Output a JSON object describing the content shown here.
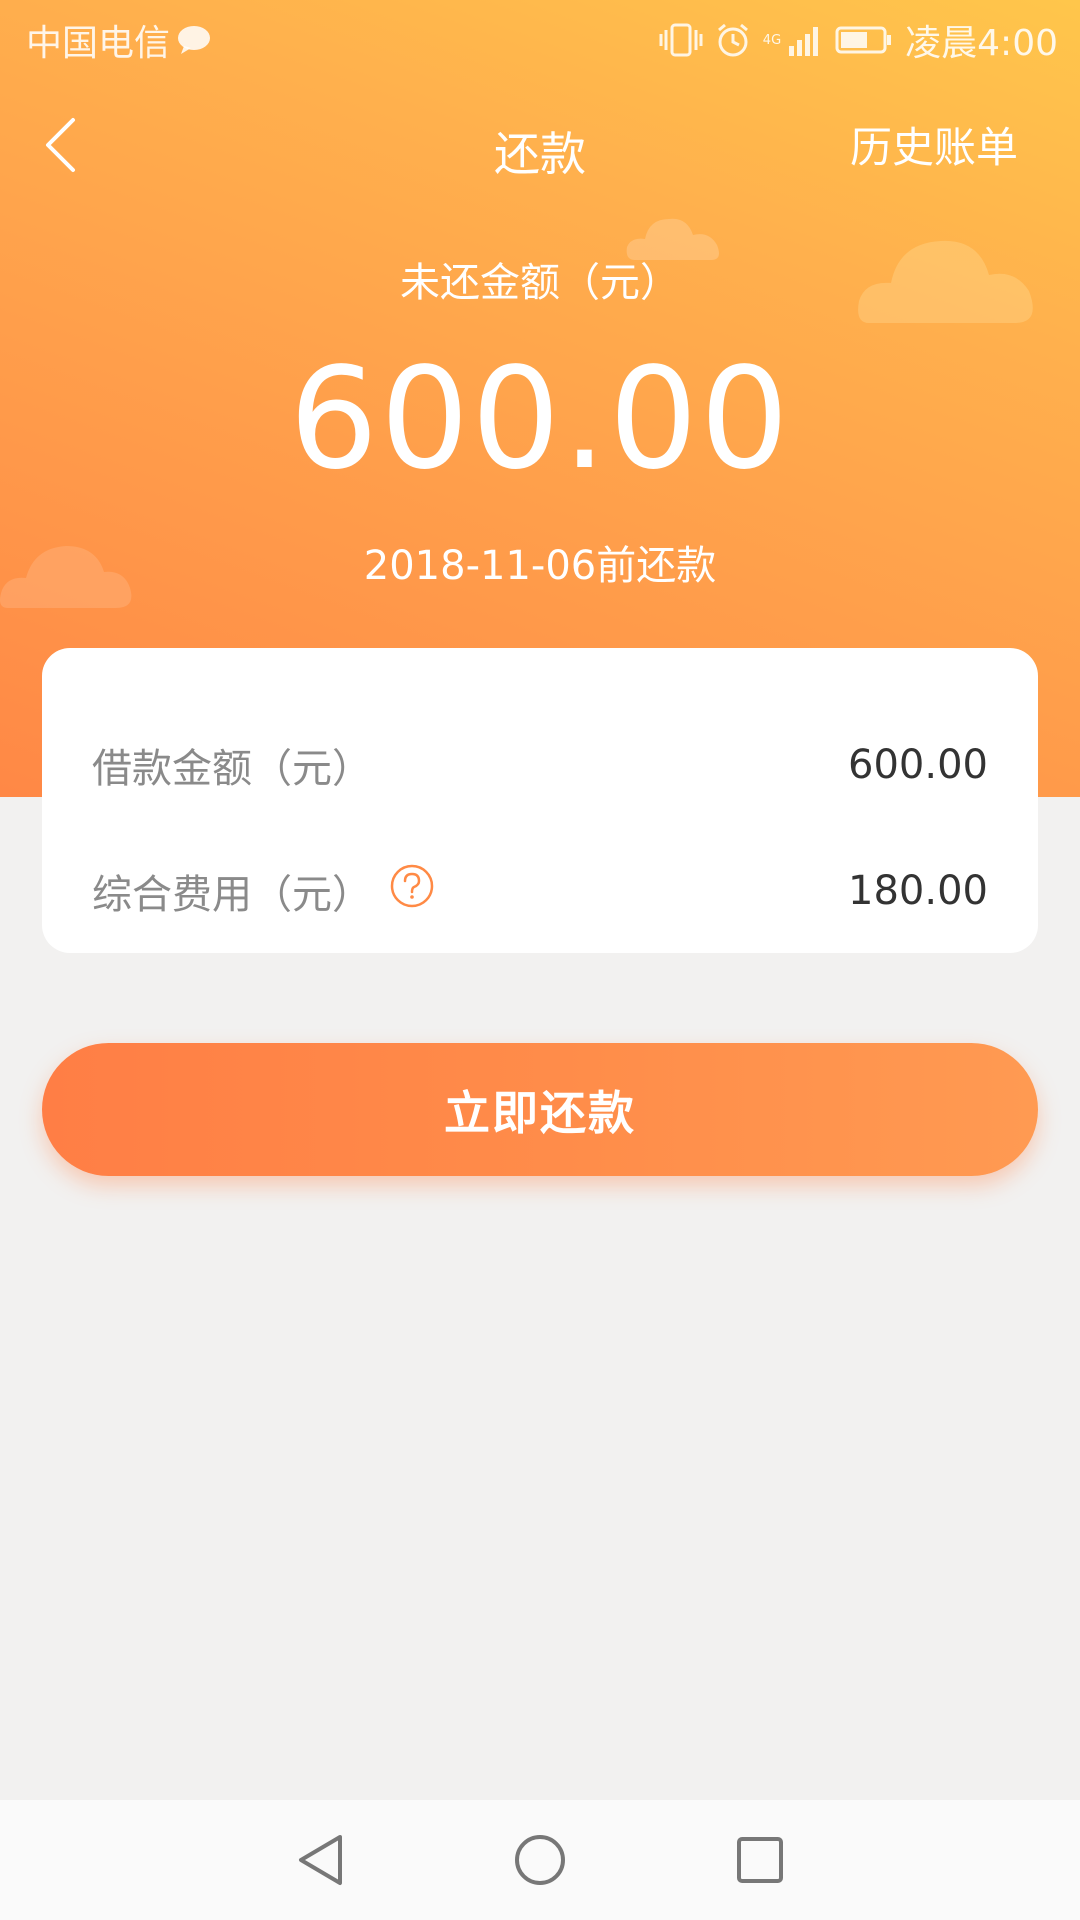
{
  "status_bar": {
    "carrier": "中国电信",
    "network": "4G",
    "time": "凌晨4:00"
  },
  "nav": {
    "title": "还款",
    "history_label": "历史账单"
  },
  "summary": {
    "amount_label": "未还金额（元）",
    "amount_value": "600.00",
    "due_text": "2018-11-06前还款"
  },
  "details": {
    "rows": [
      {
        "label": "借款金额（元）",
        "value": "600.00"
      },
      {
        "label": "综合费用（元）",
        "value": "180.00"
      }
    ]
  },
  "actions": {
    "pay_label": "立即还款"
  },
  "colors": {
    "accent": "#ff8a45",
    "background": "#f2f1f0"
  }
}
